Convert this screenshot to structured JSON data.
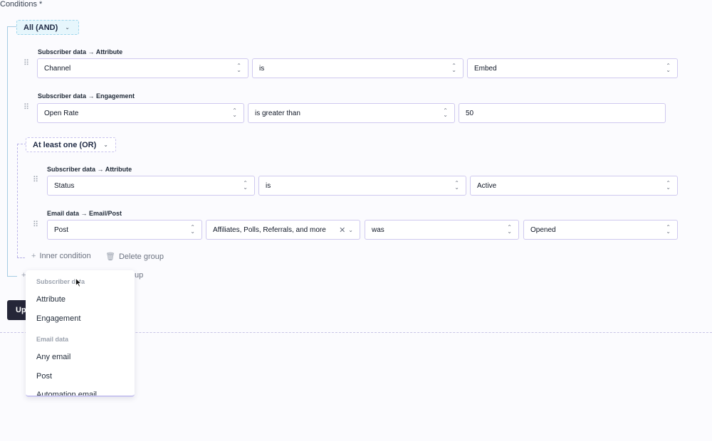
{
  "heading": "Conditions *",
  "root_group": {
    "operator_label": "All (AND)",
    "conditions": [
      {
        "path": "Subscriber data → Attribute",
        "field": "Channel",
        "operator": "is",
        "value": "Embed"
      },
      {
        "path": "Subscriber data → Engagement",
        "field": "Open Rate",
        "operator": "is greater than",
        "value": "50"
      }
    ],
    "add_condition_partial": "+",
    "add_group_partial": "up"
  },
  "nested_group": {
    "operator_label": "At least one (OR)",
    "conditions": [
      {
        "path": "Subscriber data → Attribute",
        "field": "Status",
        "operator": "is",
        "value": "Active"
      },
      {
        "path": "Email data → Email/Post",
        "field": "Post",
        "multi_value": "Affiliates, Polls, Referrals, and more",
        "operator": "was",
        "value": "Opened"
      }
    ],
    "inner_condition_label": "Inner condition",
    "delete_group_label": "Delete group"
  },
  "update_button_partial": "Up",
  "dropdown_menu": {
    "sections": [
      {
        "header": "Subscriber data",
        "items": [
          "Attribute",
          "Engagement"
        ]
      },
      {
        "header": "Email data",
        "items": [
          "Any email",
          "Post",
          "Automation email"
        ]
      }
    ]
  },
  "icons": {
    "plus": "plus-icon",
    "trash": "trash-icon",
    "drag": "drag-handle-icon",
    "updown": "select-arrows-icon",
    "chevron": "chevron-down-icon",
    "clear": "close-icon"
  },
  "colors": {
    "and_group_bg": "#e6f6fc",
    "field_border": "#cfc9ef",
    "update_button_bg": "#252638"
  }
}
